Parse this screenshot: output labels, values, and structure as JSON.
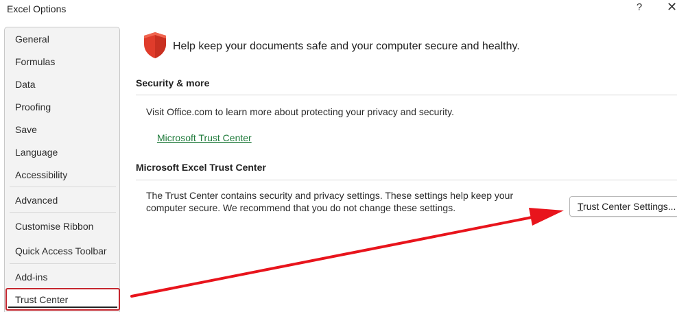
{
  "window": {
    "title": "Excel Options",
    "help_glyph": "?",
    "close_glyph": "✕"
  },
  "sidebar": {
    "items": [
      {
        "label": "General"
      },
      {
        "label": "Formulas"
      },
      {
        "label": "Data"
      },
      {
        "label": "Proofing"
      },
      {
        "label": "Save"
      },
      {
        "label": "Language"
      },
      {
        "label": "Accessibility"
      },
      {
        "label": "Advanced"
      },
      {
        "label": "Customise Ribbon"
      },
      {
        "label": "Quick Access Toolbar"
      },
      {
        "label": "Add-ins"
      },
      {
        "label": "Trust Center",
        "selected": true
      }
    ]
  },
  "main": {
    "headline": "Help keep your documents safe and your computer secure and healthy.",
    "security": {
      "title": "Security & more",
      "text": "Visit Office.com to learn more about protecting your privacy and security.",
      "link": "Microsoft Trust Center"
    },
    "trust_center": {
      "title": "Microsoft Excel Trust Center",
      "text_line1": "The Trust Center contains security and privacy settings. These settings help keep your",
      "text_line2": "computer secure. We recommend that you do not change these settings.",
      "button_accel": "T",
      "button_rest": "rust Center Settings..."
    }
  },
  "colors": {
    "accent_red": "#e03c2b",
    "link_green": "#1e7a3a",
    "selection_border": "#c4262e",
    "arrow": "#e8141c"
  },
  "icons": {
    "shield": "shield-icon"
  }
}
